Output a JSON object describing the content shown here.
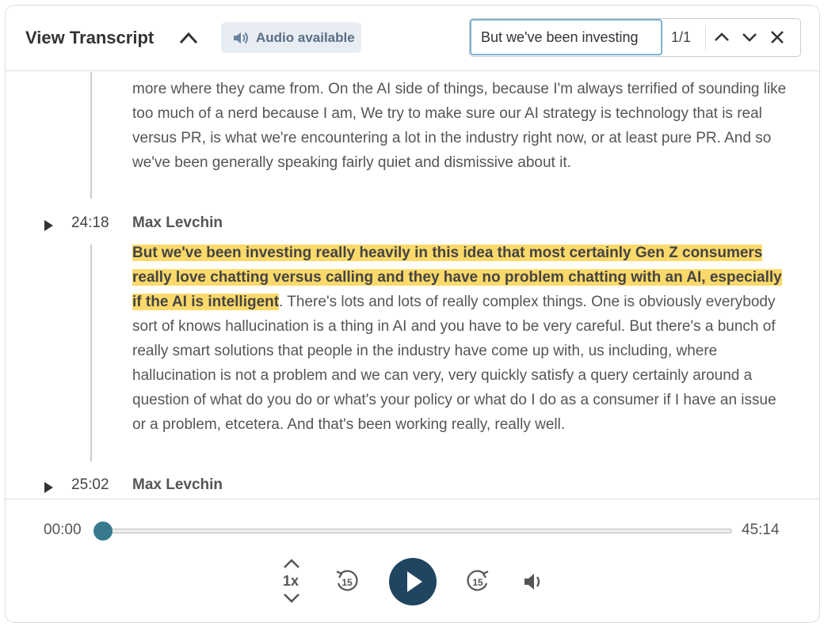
{
  "header": {
    "title": "View Transcript",
    "audio_label": "Audio available",
    "search_value": "But we've been investing",
    "match_count": "1/1"
  },
  "segments": [
    {
      "text": "more where they came from. On the AI side of things, because I'm always terrified of sounding like too much of a nerd because I am, We try to make sure our AI strategy is technology that is real versus PR, is what we're encountering a lot in the industry right now, or at least pure PR. And so we've been generally speaking fairly quiet and dismissive about it."
    },
    {
      "timestamp": "24:18",
      "speaker": "Max Levchin",
      "highlight": "But we've been investing really heavily in this idea that most certainly Gen Z consumers really love chatting versus calling and they have no problem chatting with an AI, especially if the AI is intelligent",
      "text": ". There's lots and lots of really complex things. One is obviously everybody sort of knows hallucination is a thing in AI and you have to be very careful. But there's a bunch of really smart solutions that people in the industry have come up with, us including, where hallucination is not a problem and we can very, very quickly satisfy a query certainly around a question of what do you do or what's your policy or what do I do as a consumer if I have an issue or a problem, etcetera. And that's been working really, really well."
    },
    {
      "timestamp": "25:02",
      "speaker": "Max Levchin"
    }
  ],
  "player": {
    "current": "00:00",
    "duration": "45:14",
    "progress": 0,
    "speed": "1x",
    "skip_seconds": "15",
    "accent": "#377a8f",
    "play_color": "#1f4560"
  },
  "colors": {
    "highlight": "#fbd96a",
    "audio_badge_bg": "#e8edf3"
  }
}
